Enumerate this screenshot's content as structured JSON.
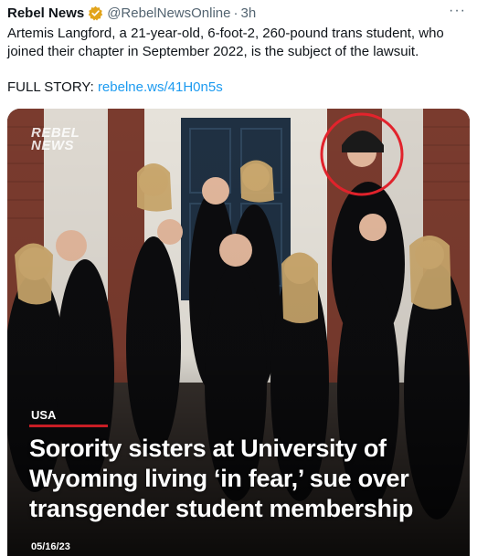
{
  "tweet": {
    "author_name": "Rebel News",
    "author_handle": "@RebelNewsOnline",
    "separator": "·",
    "timestamp": "3h",
    "more_label": "···",
    "body": "Artemis Langford, a 21-year-old, 6-foot-2, 260-pound trans student, who joined their chapter in September 2022, is the subject of the lawsuit.",
    "story_label": "FULL STORY:",
    "story_link": "rebelne.ws/41H0n5s"
  },
  "media_card": {
    "watermark_line1": "REBEL",
    "watermark_line2": "NEWS",
    "category": "USA",
    "headline": "Sorority sisters at University of Wyoming living ‘in fear,’ sue over transgender student membership",
    "date": "05/16/23"
  },
  "colors": {
    "verified_badge": "#e2a41b",
    "link": "#1d9bf0",
    "accent_red": "#c81d25",
    "text_secondary": "#536471"
  },
  "icons": [
    "verified-badge-icon",
    "more-options-icon"
  ]
}
